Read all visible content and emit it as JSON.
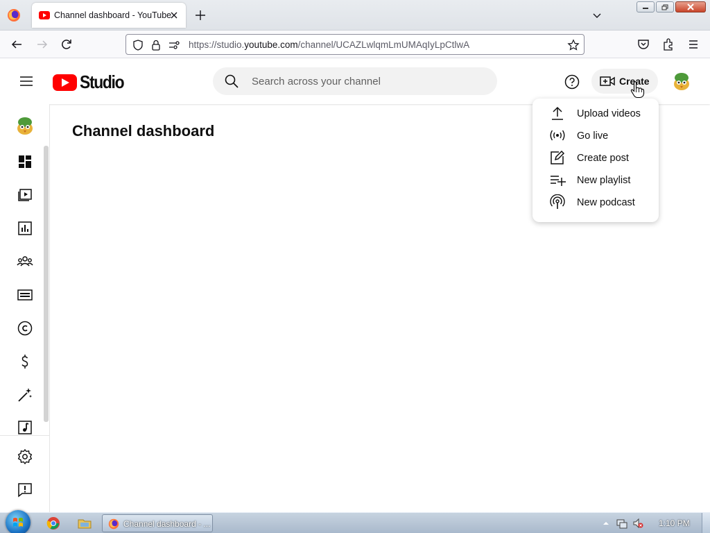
{
  "browser": {
    "tab_title": "Channel dashboard - YouTube Studio",
    "url_prefix": "https://studio.",
    "url_host": "youtube.com",
    "url_path": "/channel/UCAZLwlqmLmUMAqIyLpCtlwA"
  },
  "header": {
    "logo_text": "Studio",
    "search_placeholder": "Search across your channel",
    "create_label": "Create"
  },
  "main": {
    "title": "Channel dashboard"
  },
  "create_menu": {
    "items": [
      {
        "label": "Upload videos",
        "icon": "upload-icon"
      },
      {
        "label": "Go live",
        "icon": "live-icon"
      },
      {
        "label": "Create post",
        "icon": "post-icon"
      },
      {
        "label": "New playlist",
        "icon": "playlist-add-icon"
      },
      {
        "label": "New podcast",
        "icon": "podcast-icon"
      }
    ]
  },
  "sidebar": {
    "items": [
      "dashboard-icon",
      "content-icon",
      "analytics-icon",
      "community-icon",
      "subtitles-icon",
      "copyright-icon",
      "earn-icon",
      "customization-icon",
      "audio-library-icon",
      "settings-icon",
      "feedback-icon"
    ]
  },
  "taskbar": {
    "task_label": "Channel dashboard - ...",
    "clock": "1:10 PM"
  },
  "colors": {
    "brand_red": "#ff0000",
    "text": "#0f0f0f",
    "chip_bg": "#f2f2f2"
  }
}
